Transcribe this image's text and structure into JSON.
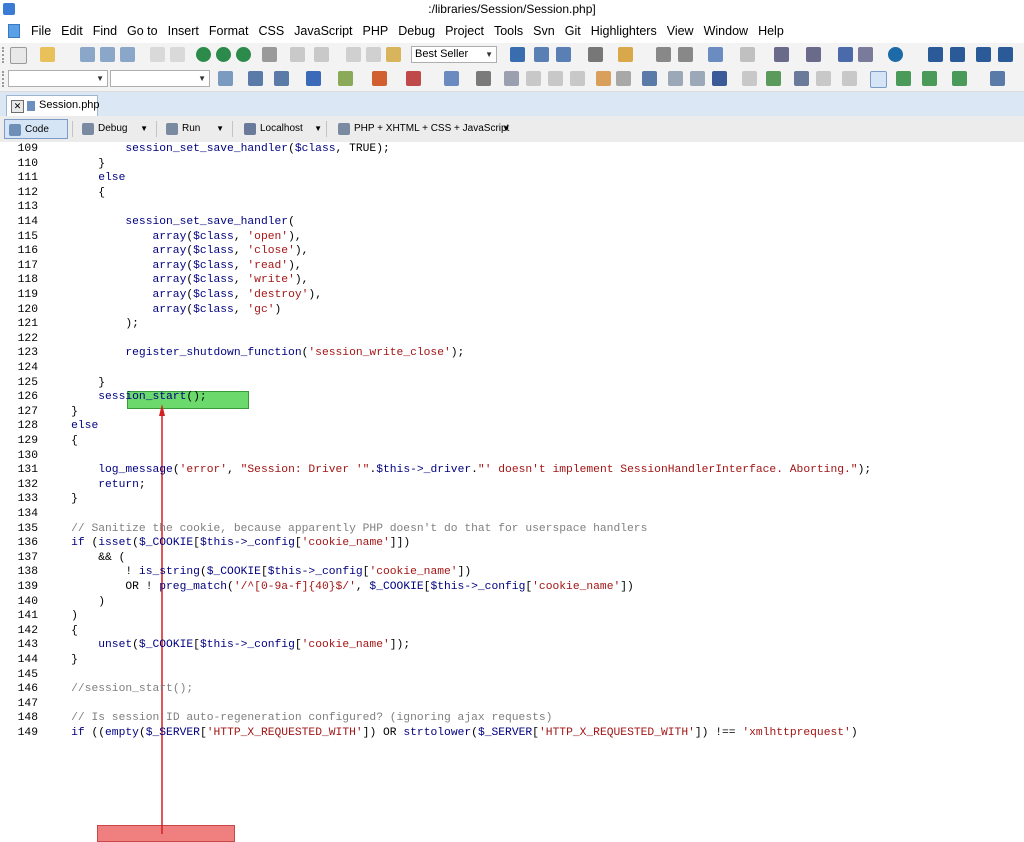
{
  "window": {
    "title": ":/libraries/Session/Session.php]"
  },
  "menu": [
    "File",
    "Edit",
    "Find",
    "Go to",
    "Insert",
    "Format",
    "CSS",
    "JavaScript",
    "PHP",
    "Debug",
    "Project",
    "Tools",
    "Svn",
    "Git",
    "Highlighters",
    "View",
    "Window",
    "Help"
  ],
  "toolbar": {
    "font_select": "Best Seller"
  },
  "tabs": [
    {
      "label": "Session.php"
    }
  ],
  "viewbar": {
    "code": "Code",
    "debug": "Debug",
    "run": "Run",
    "server": "Localhost",
    "doctype": "PHP + XHTML + CSS + JavaScript"
  },
  "code_lines": [
    {
      "n": "109",
      "segs": [
        [
          "            ",
          "t"
        ],
        [
          "session_set_save_handler",
          "f"
        ],
        [
          "(",
          "t"
        ],
        [
          "$class",
          "v"
        ],
        [
          ", TRUE);",
          "t"
        ]
      ]
    },
    {
      "n": "110",
      "segs": [
        [
          "        }",
          "t"
        ]
      ]
    },
    {
      "n": "111",
      "segs": [
        [
          "        ",
          "t"
        ],
        [
          "else",
          "k"
        ]
      ]
    },
    {
      "n": "112",
      "segs": [
        [
          "        {",
          "t"
        ]
      ]
    },
    {
      "n": "113",
      "segs": [
        [
          "",
          "t"
        ]
      ]
    },
    {
      "n": "114",
      "segs": [
        [
          "            ",
          "t"
        ],
        [
          "session_set_save_handler",
          "f"
        ],
        [
          "(",
          "t"
        ]
      ]
    },
    {
      "n": "115",
      "segs": [
        [
          "                ",
          "t"
        ],
        [
          "array",
          "f"
        ],
        [
          "(",
          "t"
        ],
        [
          "$class",
          "v"
        ],
        [
          ", ",
          "t"
        ],
        [
          "'open'",
          "s"
        ],
        [
          "),",
          "t"
        ]
      ]
    },
    {
      "n": "116",
      "segs": [
        [
          "                ",
          "t"
        ],
        [
          "array",
          "f"
        ],
        [
          "(",
          "t"
        ],
        [
          "$class",
          "v"
        ],
        [
          ", ",
          "t"
        ],
        [
          "'close'",
          "s"
        ],
        [
          "),",
          "t"
        ]
      ]
    },
    {
      "n": "117",
      "segs": [
        [
          "                ",
          "t"
        ],
        [
          "array",
          "f"
        ],
        [
          "(",
          "t"
        ],
        [
          "$class",
          "v"
        ],
        [
          ", ",
          "t"
        ],
        [
          "'read'",
          "s"
        ],
        [
          "),",
          "t"
        ]
      ]
    },
    {
      "n": "118",
      "segs": [
        [
          "                ",
          "t"
        ],
        [
          "array",
          "f"
        ],
        [
          "(",
          "t"
        ],
        [
          "$class",
          "v"
        ],
        [
          ", ",
          "t"
        ],
        [
          "'write'",
          "s"
        ],
        [
          "),",
          "t"
        ]
      ]
    },
    {
      "n": "119",
      "segs": [
        [
          "                ",
          "t"
        ],
        [
          "array",
          "f"
        ],
        [
          "(",
          "t"
        ],
        [
          "$class",
          "v"
        ],
        [
          ", ",
          "t"
        ],
        [
          "'destroy'",
          "s"
        ],
        [
          "),",
          "t"
        ]
      ]
    },
    {
      "n": "120",
      "segs": [
        [
          "                ",
          "t"
        ],
        [
          "array",
          "f"
        ],
        [
          "(",
          "t"
        ],
        [
          "$class",
          "v"
        ],
        [
          ", ",
          "t"
        ],
        [
          "'gc'",
          "s"
        ],
        [
          ")",
          "t"
        ]
      ]
    },
    {
      "n": "121",
      "segs": [
        [
          "            );",
          "t"
        ]
      ]
    },
    {
      "n": "122",
      "segs": [
        [
          "",
          "t"
        ]
      ]
    },
    {
      "n": "123",
      "segs": [
        [
          "            ",
          "t"
        ],
        [
          "register_shutdown_function",
          "f"
        ],
        [
          "(",
          "t"
        ],
        [
          "'session_write_close'",
          "s"
        ],
        [
          ");",
          "t"
        ]
      ]
    },
    {
      "n": "124",
      "segs": [
        [
          "",
          "t"
        ]
      ]
    },
    {
      "n": "125",
      "segs": [
        [
          "        }",
          "t"
        ]
      ]
    },
    {
      "n": "126",
      "segs": [
        [
          "        ",
          "t"
        ],
        [
          "session_start",
          "f"
        ],
        [
          "();",
          "t"
        ]
      ]
    },
    {
      "n": "127",
      "segs": [
        [
          "    }",
          "t"
        ]
      ]
    },
    {
      "n": "128",
      "segs": [
        [
          "    ",
          "t"
        ],
        [
          "else",
          "k"
        ]
      ]
    },
    {
      "n": "129",
      "segs": [
        [
          "    {",
          "t"
        ]
      ]
    },
    {
      "n": "130",
      "segs": [
        [
          "",
          "t"
        ]
      ]
    },
    {
      "n": "131",
      "segs": [
        [
          "        ",
          "t"
        ],
        [
          "log_message",
          "f"
        ],
        [
          "(",
          "t"
        ],
        [
          "'error'",
          "s"
        ],
        [
          ", ",
          "t"
        ],
        [
          "\"Session: Driver '\"",
          "s"
        ],
        [
          ".",
          "t"
        ],
        [
          "$this",
          "v"
        ],
        [
          "->_driver",
          "v"
        ],
        [
          ".",
          "t"
        ],
        [
          "\"' doesn't implement SessionHandlerInterface. Aborting.\"",
          "s"
        ],
        [
          ");",
          "t"
        ]
      ]
    },
    {
      "n": "132",
      "segs": [
        [
          "        ",
          "t"
        ],
        [
          "return",
          "k"
        ],
        [
          ";",
          "t"
        ]
      ]
    },
    {
      "n": "133",
      "segs": [
        [
          "    }",
          "t"
        ]
      ]
    },
    {
      "n": "134",
      "segs": [
        [
          "",
          "t"
        ]
      ]
    },
    {
      "n": "135",
      "segs": [
        [
          "    ",
          "t"
        ],
        [
          "// Sanitize the cookie, because apparently PHP doesn't do that for userspace handlers",
          "c"
        ]
      ]
    },
    {
      "n": "136",
      "segs": [
        [
          "    ",
          "t"
        ],
        [
          "if",
          "k"
        ],
        [
          " (",
          "t"
        ],
        [
          "isset",
          "f"
        ],
        [
          "(",
          "t"
        ],
        [
          "$_COOKIE",
          "v"
        ],
        [
          "[",
          "t"
        ],
        [
          "$this",
          "v"
        ],
        [
          "->_config",
          "v"
        ],
        [
          "[",
          "t"
        ],
        [
          "'cookie_name'",
          "s"
        ],
        [
          "]])",
          "t"
        ]
      ]
    },
    {
      "n": "137",
      "segs": [
        [
          "        && (",
          "t"
        ]
      ]
    },
    {
      "n": "138",
      "segs": [
        [
          "            ! ",
          "t"
        ],
        [
          "is_string",
          "f"
        ],
        [
          "(",
          "t"
        ],
        [
          "$_COOKIE",
          "v"
        ],
        [
          "[",
          "t"
        ],
        [
          "$this",
          "v"
        ],
        [
          "->_config",
          "v"
        ],
        [
          "[",
          "t"
        ],
        [
          "'cookie_name'",
          "s"
        ],
        [
          "])",
          "t"
        ]
      ]
    },
    {
      "n": "139",
      "segs": [
        [
          "            OR ! ",
          "t"
        ],
        [
          "preg_match",
          "f"
        ],
        [
          "(",
          "t"
        ],
        [
          "'/^[0-9a-f]{40}$/'",
          "s"
        ],
        [
          ", ",
          "t"
        ],
        [
          "$_COOKIE",
          "v"
        ],
        [
          "[",
          "t"
        ],
        [
          "$this",
          "v"
        ],
        [
          "->_config",
          "v"
        ],
        [
          "[",
          "t"
        ],
        [
          "'cookie_name'",
          "s"
        ],
        [
          "])",
          "t"
        ]
      ]
    },
    {
      "n": "140",
      "segs": [
        [
          "        )",
          "t"
        ]
      ]
    },
    {
      "n": "141",
      "segs": [
        [
          "    )",
          "t"
        ]
      ]
    },
    {
      "n": "142",
      "segs": [
        [
          "    {",
          "t"
        ]
      ]
    },
    {
      "n": "143",
      "segs": [
        [
          "        ",
          "t"
        ],
        [
          "unset",
          "f"
        ],
        [
          "(",
          "t"
        ],
        [
          "$_COOKIE",
          "v"
        ],
        [
          "[",
          "t"
        ],
        [
          "$this",
          "v"
        ],
        [
          "->_config",
          "v"
        ],
        [
          "[",
          "t"
        ],
        [
          "'cookie_name'",
          "s"
        ],
        [
          "]);",
          "t"
        ]
      ]
    },
    {
      "n": "144",
      "segs": [
        [
          "    }",
          "t"
        ]
      ]
    },
    {
      "n": "145",
      "segs": [
        [
          "",
          "t"
        ]
      ]
    },
    {
      "n": "146",
      "segs": [
        [
          "    ",
          "t"
        ],
        [
          "//session_start();",
          "c"
        ]
      ]
    },
    {
      "n": "147",
      "segs": [
        [
          "",
          "t"
        ]
      ]
    },
    {
      "n": "148",
      "segs": [
        [
          "    ",
          "t"
        ],
        [
          "// Is session ID auto-regeneration configured? (ignoring ajax requests)",
          "c"
        ]
      ]
    },
    {
      "n": "149",
      "segs": [
        [
          "    ",
          "t"
        ],
        [
          "if",
          "k"
        ],
        [
          " ((",
          "t"
        ],
        [
          "empty",
          "f"
        ],
        [
          "(",
          "t"
        ],
        [
          "$_SERVER",
          "v"
        ],
        [
          "[",
          "t"
        ],
        [
          "'HTTP_X_REQUESTED_WITH'",
          "s"
        ],
        [
          "]) OR ",
          "t"
        ],
        [
          "strtolower",
          "f"
        ],
        [
          "(",
          "t"
        ],
        [
          "$_SERVER",
          "v"
        ],
        [
          "[",
          "t"
        ],
        [
          "'HTTP_X_REQUESTED_WITH'",
          "s"
        ],
        [
          "]) !== ",
          "t"
        ],
        [
          "'xmlhttprequest'",
          "s"
        ],
        [
          ")",
          "t"
        ]
      ]
    }
  ],
  "colors": {
    "highlight_added": "#6bd96b",
    "highlight_removed": "#f08080",
    "arrow": "#d42020",
    "keyword": "#000080",
    "string": "#a31515",
    "comment": "#7f7f7f"
  }
}
